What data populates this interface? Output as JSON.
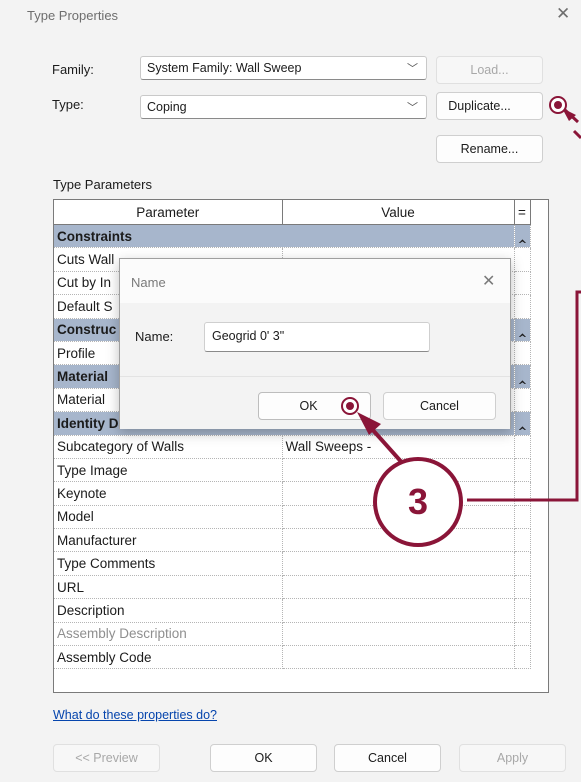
{
  "window": {
    "title": "Type Properties",
    "close_icon": "close-icon"
  },
  "family": {
    "label": "Family:",
    "value": "System Family: Wall Sweep",
    "load_label": "Load..."
  },
  "type": {
    "label": "Type:",
    "value": "Coping",
    "duplicate_label": "Duplicate...",
    "rename_label": "Rename..."
  },
  "type_parameters_label": "Type Parameters",
  "grid": {
    "header": {
      "parameter": "Parameter",
      "value": "Value",
      "sort": "="
    },
    "rows": [
      {
        "kind": "group",
        "name": "Constraints",
        "icon": "collapse-icon",
        "glyph": "‸"
      },
      {
        "kind": "row",
        "name": "Cuts Wall",
        "value": ""
      },
      {
        "kind": "row",
        "name": "Cut by In",
        "value": ""
      },
      {
        "kind": "row",
        "name": "Default S",
        "value": ""
      },
      {
        "kind": "group",
        "name": "Construc",
        "icon": "collapse-icon",
        "glyph": "‸"
      },
      {
        "kind": "row",
        "name": "Profile",
        "value": ""
      },
      {
        "kind": "group",
        "name": "Material",
        "icon": "collapse-icon",
        "glyph": "‸"
      },
      {
        "kind": "row",
        "name": "Material",
        "value": ""
      },
      {
        "kind": "group",
        "name": "Identity Data",
        "icon": "collapse-icon",
        "glyph": "‸"
      },
      {
        "kind": "row",
        "name": "Subcategory of Walls",
        "value": "Wall Sweeps -"
      },
      {
        "kind": "row",
        "name": "Type Image",
        "value": ""
      },
      {
        "kind": "row",
        "name": "Keynote",
        "value": ""
      },
      {
        "kind": "row",
        "name": "Model",
        "value": ""
      },
      {
        "kind": "row",
        "name": "Manufacturer",
        "value": ""
      },
      {
        "kind": "row",
        "name": "Type Comments",
        "value": ""
      },
      {
        "kind": "row",
        "name": "URL",
        "value": ""
      },
      {
        "kind": "row",
        "name": "Description",
        "value": ""
      },
      {
        "kind": "row",
        "name": "Assembly Description",
        "value": "",
        "muted": true
      },
      {
        "kind": "row",
        "name": "Assembly Code",
        "value": ""
      }
    ]
  },
  "help_link": "What do these properties do?",
  "footer": {
    "preview": "<< Preview",
    "ok": "OK",
    "cancel": "Cancel",
    "apply": "Apply"
  },
  "name_dialog": {
    "title": "Name",
    "name_label": "Name:",
    "name_value": "Geogrid 0' 3\"",
    "ok": "OK",
    "cancel": "Cancel"
  },
  "annotation": {
    "step_number": "3",
    "accent_color": "#8a1538",
    "group_header_color": "#a7b6cc"
  }
}
